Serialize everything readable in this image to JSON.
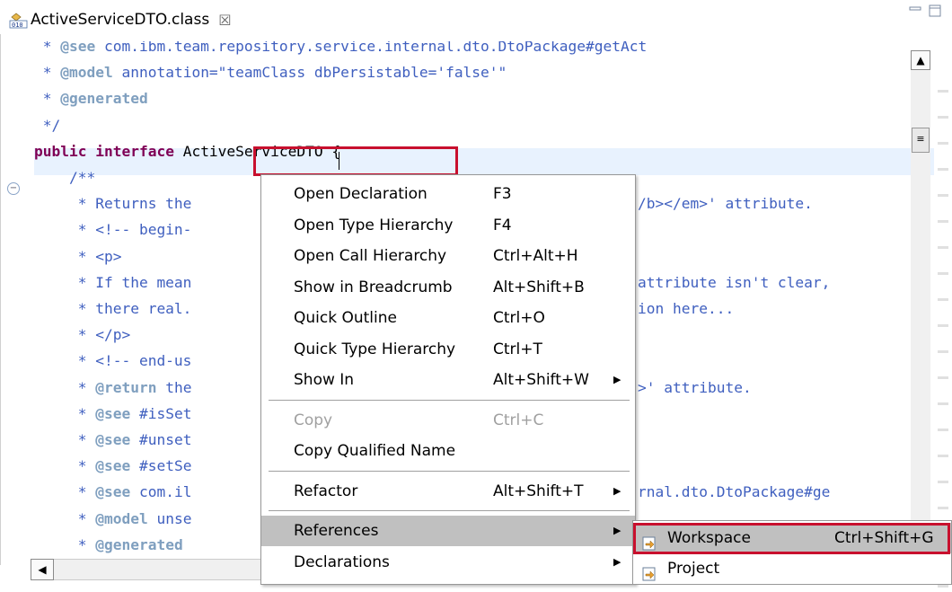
{
  "tab": {
    "title": "ActiveServiceDTO.class",
    "close_glyph": "☒",
    "icon": "class-file-icon"
  },
  "code_lines": [
    [
      [
        "c-cmt",
        " * "
      ],
      [
        "c-tag",
        "@see"
      ],
      [
        "c-cmt",
        " com.ibm.team.repository.service.internal.dto.DtoPackage#getAct"
      ]
    ],
    [
      [
        "c-cmt",
        " * "
      ],
      [
        "c-tag",
        "@model"
      ],
      [
        "c-cmt",
        " annotation=\"teamClass dbPersistable='false'\""
      ]
    ],
    [
      [
        "c-cmt",
        " * "
      ],
      [
        "c-tag",
        "@generated"
      ]
    ],
    [
      [
        "c-cmt",
        " */"
      ]
    ],
    [
      [
        "c-kw",
        "public"
      ],
      [
        "c-txt",
        " "
      ],
      [
        "c-kw",
        "interface"
      ],
      [
        "c-txt",
        " ActiveServiceDTO {"
      ]
    ],
    [
      [
        "c-cmt",
        "    /**"
      ]
    ],
    [
      [
        "c-cmt",
        "     * Returns the"
      ]
    ],
    [
      [
        "c-cmt",
        "     * <!-- begin-"
      ]
    ],
    [
      [
        "c-cmt",
        "     * <p>"
      ]
    ],
    [
      [
        "c-cmt",
        "     * If the mean"
      ]
    ],
    [
      [
        "c-cmt",
        "     * there real."
      ]
    ],
    [
      [
        "c-cmt",
        "     * </p>"
      ]
    ],
    [
      [
        "c-cmt",
        "     * <!-- end-us"
      ]
    ],
    [
      [
        "c-cmt",
        "     * "
      ],
      [
        "c-tag",
        "@return"
      ],
      [
        "c-cmt",
        " the"
      ]
    ],
    [
      [
        "c-cmt",
        "     * "
      ],
      [
        "c-tag",
        "@see"
      ],
      [
        "c-cmt",
        " #isSet"
      ]
    ],
    [
      [
        "c-cmt",
        "     * "
      ],
      [
        "c-tag",
        "@see"
      ],
      [
        "c-cmt",
        " #unset"
      ]
    ],
    [
      [
        "c-cmt",
        "     * "
      ],
      [
        "c-tag",
        "@see"
      ],
      [
        "c-cmt",
        " #setSe"
      ]
    ],
    [
      [
        "c-cmt",
        "     * "
      ],
      [
        "c-tag",
        "@see"
      ],
      [
        "c-cmt",
        " com.il"
      ]
    ],
    [
      [
        "c-cmt",
        "     * "
      ],
      [
        "c-tag",
        "@model"
      ],
      [
        "c-cmt",
        " unse"
      ]
    ],
    [
      [
        "c-cmt",
        "     * "
      ],
      [
        "c-tag",
        "@generated"
      ]
    ]
  ],
  "right_fragments": [
    {
      "line": 6,
      "text": "/b></em>' attribute."
    },
    {
      "line": 9,
      "text": "attribute isn't clear,"
    },
    {
      "line": 10,
      "text": "ion here..."
    },
    {
      "line": 13,
      "text": ">' attribute."
    },
    {
      "line": 17,
      "text": "rnal.dto.DtoPackage#ge"
    }
  ],
  "context_menu": {
    "items": [
      {
        "label": "Open Declaration",
        "accel": "F3",
        "submenu": false,
        "disabled": false,
        "selected": false
      },
      {
        "label": "Open Type Hierarchy",
        "accel": "F4",
        "submenu": false,
        "disabled": false,
        "selected": false
      },
      {
        "label": "Open Call Hierarchy",
        "accel": "Ctrl+Alt+H",
        "submenu": false,
        "disabled": false,
        "selected": false
      },
      {
        "label": "Show in Breadcrumb",
        "accel": "Alt+Shift+B",
        "submenu": false,
        "disabled": false,
        "selected": false
      },
      {
        "label": "Quick Outline",
        "accel": "Ctrl+O",
        "submenu": false,
        "disabled": false,
        "selected": false
      },
      {
        "label": "Quick Type Hierarchy",
        "accel": "Ctrl+T",
        "submenu": false,
        "disabled": false,
        "selected": false
      },
      {
        "label": "Show In",
        "accel": "Alt+Shift+W",
        "submenu": true,
        "disabled": false,
        "selected": false
      },
      {
        "separator": true
      },
      {
        "label": "Copy",
        "accel": "Ctrl+C",
        "submenu": false,
        "disabled": true,
        "selected": false
      },
      {
        "label": "Copy Qualified Name",
        "accel": "",
        "submenu": false,
        "disabled": false,
        "selected": false
      },
      {
        "separator": true
      },
      {
        "label": "Refactor",
        "accel": "Alt+Shift+T",
        "submenu": true,
        "disabled": false,
        "selected": false
      },
      {
        "separator": true
      },
      {
        "label": "References",
        "accel": "",
        "submenu": true,
        "disabled": false,
        "selected": true
      },
      {
        "label": "Declarations",
        "accel": "",
        "submenu": true,
        "disabled": false,
        "selected": false
      }
    ]
  },
  "submenu": {
    "items": [
      {
        "label": "Workspace",
        "accel": "Ctrl+Shift+G",
        "selected": true
      },
      {
        "label": "Project",
        "accel": "",
        "selected": false
      }
    ]
  }
}
